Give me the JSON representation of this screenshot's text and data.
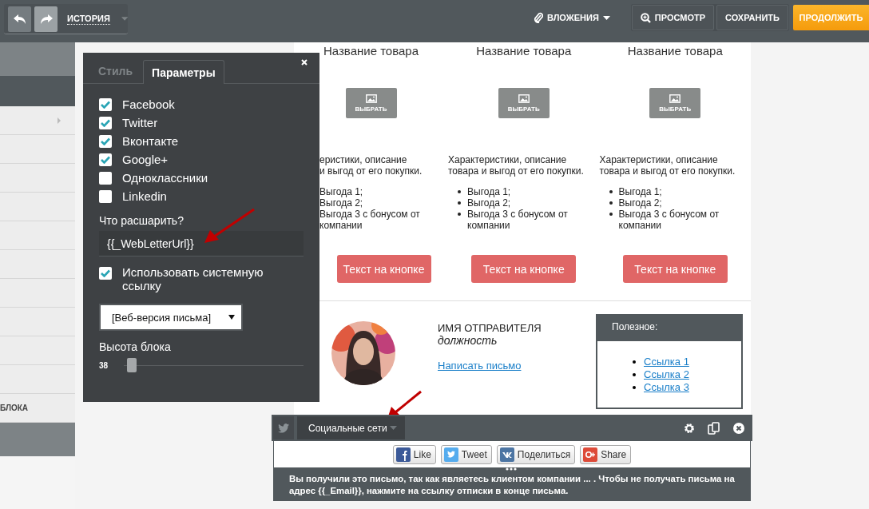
{
  "toolbar": {
    "history": "ИСТОРИЯ",
    "attachments": "ВЛОЖЕНИЯ",
    "preview": "ПРОСМОТР",
    "save": "СОХРАНИТЬ",
    "continue": "ПРОДОЛЖИТЬ"
  },
  "sidebar": {
    "label": "БЛОКА"
  },
  "panel": {
    "tabs": [
      {
        "label": "Стиль",
        "selected": false
      },
      {
        "label": "Параметры",
        "selected": true
      }
    ],
    "networks": [
      {
        "label": "Facebook",
        "checked": true
      },
      {
        "label": "Twitter",
        "checked": true
      },
      {
        "label": "Вконтакте",
        "checked": true
      },
      {
        "label": "Google+",
        "checked": true
      },
      {
        "label": "Одноклассники",
        "checked": false
      },
      {
        "label": "Linkedin",
        "checked": false
      }
    ],
    "share_label": "Что расшарить?",
    "share_value": "{{_WebLetterUrl}}",
    "system_link": {
      "label": "Использовать системную ссылку",
      "checked": true
    },
    "link_select": {
      "value": "[Веб-версия письма]"
    },
    "block_height": {
      "label": "Высота блока",
      "value": "38",
      "level": 0.02
    }
  },
  "products": [
    {
      "title": "Название товара",
      "image_button": "ВЫБРАТЬ",
      "description": [
        "еристики, описание",
        "и выгод от его покупки."
      ],
      "bullets_shown": false,
      "benefits": [
        "Выгода 1;",
        "Выгода 2;",
        "Выгода 3 с бонусом от компании"
      ],
      "button": "Текст на кнопке"
    },
    {
      "title": "Название товара",
      "image_button": "ВЫБРАТЬ",
      "description": [
        "Характеристики, описание",
        "товара и выгод от его покупки."
      ],
      "bullets_shown": true,
      "benefits": [
        "Выгода 1;",
        "Выгода 2;",
        "Выгода 3 с бонусом от компании"
      ],
      "button": "Текст на кнопке"
    },
    {
      "title": "Название товара",
      "image_button": "ВЫБРАТЬ",
      "description": [
        "Характеристики, описание",
        "товара и выгод от его покупки."
      ],
      "bullets_shown": true,
      "benefits": [
        "Выгода 1;",
        "Выгода 2;",
        "Выгода 3 с бонусом от компании"
      ],
      "button": "Текст на кнопке"
    }
  ],
  "sender": {
    "name": "ИМЯ ОТПРАВИТЕЛЯ",
    "position": "должность",
    "link": "Написать письмо"
  },
  "useful": {
    "title": "Полезное:",
    "links": [
      "Ссылка 1",
      "Ссылка 2 ",
      "Ссылка 3"
    ]
  },
  "block_bar": {
    "dropdown": "Социальные сети",
    "share_buttons": [
      {
        "kind": "facebook",
        "label": "Like"
      },
      {
        "kind": "twitter",
        "label": "Tweet"
      },
      {
        "kind": "vk",
        "label": "Поделиться"
      },
      {
        "kind": "google",
        "label": "Share"
      }
    ]
  },
  "footer_text": "Вы получили это письмо, так как являетесь клиентом компании ... . Чтобы не получать письма на адрес {{_Email}}, нажмите на ссылку отписки в конце письма."
}
